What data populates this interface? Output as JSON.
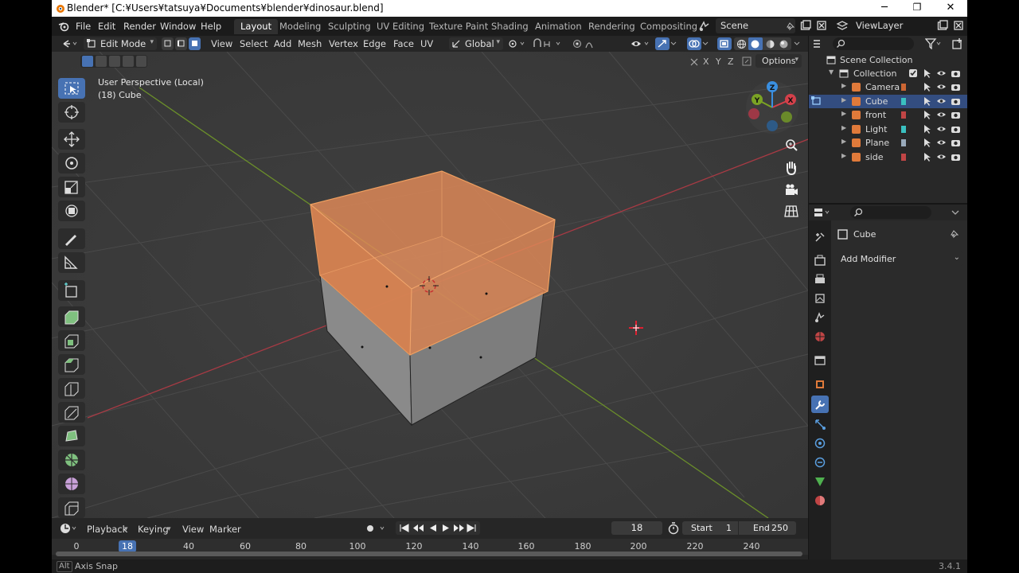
{
  "window": {
    "title": "Blender* [C:¥Users¥tatsuya¥Documents¥blender¥dinosaur.blend]",
    "min": "─",
    "restore": "❐",
    "close": "✕"
  },
  "menu": {
    "file": "File",
    "edit": "Edit",
    "render": "Render",
    "window": "Window",
    "help": "Help"
  },
  "workspaces": [
    "Layout",
    "Modeling",
    "Sculpting",
    "UV Editing",
    "Texture Paint",
    "Shading",
    "Animation",
    "Rendering",
    "Compositing"
  ],
  "scene": {
    "name": "Scene",
    "view_layer": "ViewLayer"
  },
  "viewport_header": {
    "mode": "Edit Mode",
    "view": "View",
    "select": "Select",
    "add": "Add",
    "mesh": "Mesh",
    "vertex": "Vertex",
    "edge": "Edge",
    "face": "Face",
    "uv": "UV",
    "orientation": "Global",
    "options": "Options",
    "x": "X",
    "y": "Y",
    "z": "Z"
  },
  "viewport": {
    "perspective_label": "User Perspective (Local)",
    "object_label": "(18) Cube",
    "gizmo": {
      "x": "X",
      "y": "Y",
      "z": "Z"
    }
  },
  "timeline": {
    "playback": "Playback",
    "keying": "Keying",
    "view": "View",
    "marker": "Marker",
    "current_frame": "18",
    "start_label": "Start",
    "start": "1",
    "end_label": "End",
    "end": "250",
    "ticks": [
      "0",
      "18",
      "40",
      "60",
      "80",
      "100",
      "120",
      "140",
      "160",
      "180",
      "200",
      "220",
      "240"
    ]
  },
  "status": {
    "key": "Alt",
    "hint": "Axis Snap",
    "version": "3.4.1"
  },
  "outliner": {
    "root": "Scene Collection",
    "collection": "Collection",
    "items": [
      {
        "name": "Camera"
      },
      {
        "name": "Cube"
      },
      {
        "name": "front"
      },
      {
        "name": "Light"
      },
      {
        "name": "Plane"
      },
      {
        "name": "side"
      }
    ]
  },
  "properties": {
    "object_name": "Cube",
    "add_modifier": "Add Modifier"
  },
  "colors": {
    "accent": "#4772b3",
    "selected_face": "#e8905a",
    "x_axis": "#d4404a",
    "y_axis": "#7ba324"
  }
}
